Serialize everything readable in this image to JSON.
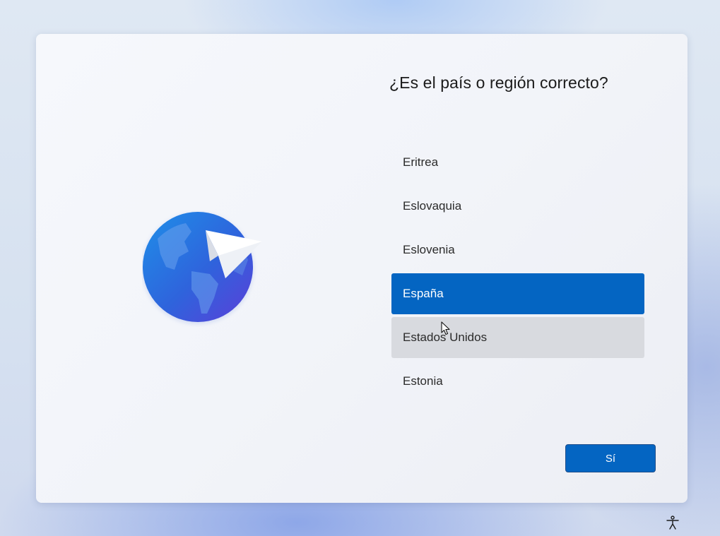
{
  "dialog": {
    "title": "¿Es el país o región correcto?",
    "countries": [
      {
        "label": "Eritrea",
        "state": "normal"
      },
      {
        "label": "Eslovaquia",
        "state": "normal"
      },
      {
        "label": "Eslovenia",
        "state": "normal"
      },
      {
        "label": "España",
        "state": "selected"
      },
      {
        "label": "Estados Unidos",
        "state": "hovered"
      },
      {
        "label": "Estonia",
        "state": "normal"
      }
    ],
    "confirm_label": "Sí"
  },
  "icons": {
    "illustration": "globe-with-paper-plane-icon",
    "cursor": "mouse-pointer-icon",
    "accessibility": "accessibility-icon"
  },
  "colors": {
    "accent": "#0465c2",
    "hover": "#d8dadf",
    "globe_dark": "#2a5bd7",
    "globe_light": "#3fa0f0"
  }
}
